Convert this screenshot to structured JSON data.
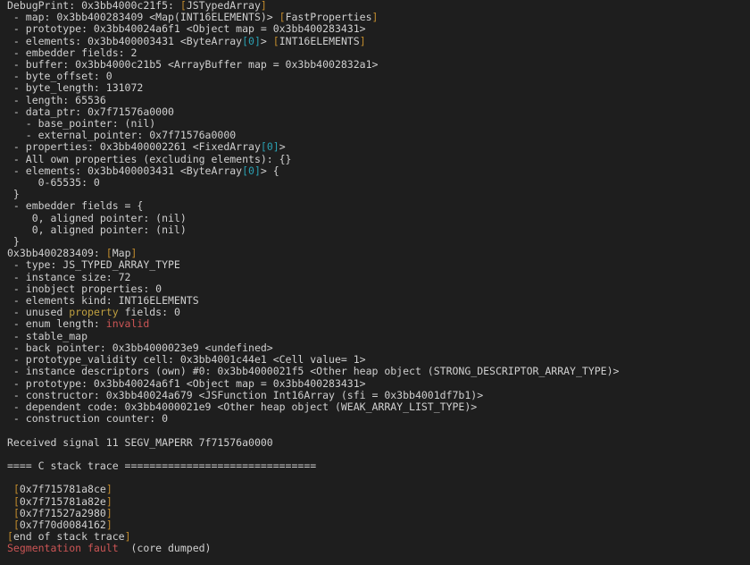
{
  "colors": {
    "bg": "#1e1e1e",
    "fg": "#d0d0d0",
    "cyan": "#2aa1b3",
    "orange": "#c08a2c",
    "yellow": "#c0a040",
    "red": "#cc5555"
  },
  "segments": [
    {
      "t": "DebugPrint: 0x3bb4000c21f5: "
    },
    {
      "t": "[",
      "c": "orange"
    },
    {
      "t": "JSTypedArray"
    },
    {
      "t": "]",
      "c": "orange"
    },
    {
      "t": "\n"
    },
    {
      "t": " - map: 0x3bb400283409 <Map(INT16ELEMENTS)> "
    },
    {
      "t": "[",
      "c": "orange"
    },
    {
      "t": "FastProperties"
    },
    {
      "t": "]",
      "c": "orange"
    },
    {
      "t": "\n"
    },
    {
      "t": " - prototype: 0x3bb40024a6f1 <Object map = 0x3bb400283431>\n"
    },
    {
      "t": " - elements: 0x3bb400003431 <ByteArray"
    },
    {
      "t": "[",
      "c": "cyan"
    },
    {
      "t": "0",
      "c": "cyan"
    },
    {
      "t": "]",
      "c": "cyan"
    },
    {
      "t": "> "
    },
    {
      "t": "[",
      "c": "orange"
    },
    {
      "t": "INT16ELEMENTS"
    },
    {
      "t": "]",
      "c": "orange"
    },
    {
      "t": "\n"
    },
    {
      "t": " - embedder fields: 2\n"
    },
    {
      "t": " - buffer: 0x3bb4000c21b5 <ArrayBuffer map = 0x3bb4002832a1>\n"
    },
    {
      "t": " - byte_offset: 0\n"
    },
    {
      "t": " - byte_length: 131072\n"
    },
    {
      "t": " - length: 65536\n"
    },
    {
      "t": " - data_ptr: 0x7f71576a0000\n"
    },
    {
      "t": "   - base_pointer: (nil)\n"
    },
    {
      "t": "   - external_pointer: 0x7f71576a0000\n"
    },
    {
      "t": " - properties: 0x3bb400002261 <FixedArray"
    },
    {
      "t": "[",
      "c": "cyan"
    },
    {
      "t": "0",
      "c": "cyan"
    },
    {
      "t": "]",
      "c": "cyan"
    },
    {
      "t": ">\n"
    },
    {
      "t": " - All own properties (excluding elements): {}\n"
    },
    {
      "t": " - elements: 0x3bb400003431 <ByteArray"
    },
    {
      "t": "[",
      "c": "cyan"
    },
    {
      "t": "0",
      "c": "cyan"
    },
    {
      "t": "]",
      "c": "cyan"
    },
    {
      "t": "> {\n"
    },
    {
      "t": "     0-65535: 0\n"
    },
    {
      "t": " }\n"
    },
    {
      "t": " - embedder fields = {\n"
    },
    {
      "t": "    0, aligned pointer: (nil)\n"
    },
    {
      "t": "    0, aligned pointer: (nil)\n"
    },
    {
      "t": " }\n"
    },
    {
      "t": "0x3bb400283409: "
    },
    {
      "t": "[",
      "c": "orange"
    },
    {
      "t": "Map"
    },
    {
      "t": "]",
      "c": "orange"
    },
    {
      "t": "\n"
    },
    {
      "t": " - type: JS_TYPED_ARRAY_TYPE\n"
    },
    {
      "t": " - instance size: 72\n"
    },
    {
      "t": " - inobject properties: 0\n"
    },
    {
      "t": " - elements kind: INT16ELEMENTS\n"
    },
    {
      "t": " - unused "
    },
    {
      "t": "property",
      "c": "yellow"
    },
    {
      "t": " fields: 0\n"
    },
    {
      "t": " - enum length: "
    },
    {
      "t": "invalid",
      "c": "red"
    },
    {
      "t": "\n"
    },
    {
      "t": " - stable_map\n"
    },
    {
      "t": " - back pointer: 0x3bb4000023e9 <undefined>\n"
    },
    {
      "t": " - prototype_validity cell: 0x3bb4001c44e1 <Cell value= 1>\n"
    },
    {
      "t": " - instance descriptors (own) #0: 0x3bb4000021f5 <Other heap object (STRONG_DESCRIPTOR_ARRAY_TYPE)>\n"
    },
    {
      "t": " - prototype: 0x3bb40024a6f1 <Object map = 0x3bb400283431>\n"
    },
    {
      "t": " - constructor: 0x3bb40024a679 <JSFunction Int16Array (sfi = 0x3bb4001df7b1)>\n"
    },
    {
      "t": " - dependent code: 0x3bb4000021e9 <Other heap object (WEAK_ARRAY_LIST_TYPE)>\n"
    },
    {
      "t": " - construction counter: 0\n"
    },
    {
      "t": "\n"
    },
    {
      "t": "Received signal 11 SEGV_MAPERR 7f71576a0000\n"
    },
    {
      "t": "\n"
    },
    {
      "t": "==== C stack trace ===============================\n"
    },
    {
      "t": "\n"
    },
    {
      "t": " "
    },
    {
      "t": "[",
      "c": "orange"
    },
    {
      "t": "0x7f715781a8ce"
    },
    {
      "t": "]",
      "c": "orange"
    },
    {
      "t": "\n"
    },
    {
      "t": " "
    },
    {
      "t": "[",
      "c": "orange"
    },
    {
      "t": "0x7f715781a82e"
    },
    {
      "t": "]",
      "c": "orange"
    },
    {
      "t": "\n"
    },
    {
      "t": " "
    },
    {
      "t": "[",
      "c": "orange"
    },
    {
      "t": "0x7f71527a2980"
    },
    {
      "t": "]",
      "c": "orange"
    },
    {
      "t": "\n"
    },
    {
      "t": " "
    },
    {
      "t": "[",
      "c": "orange"
    },
    {
      "t": "0x7f70d0084162"
    },
    {
      "t": "]",
      "c": "orange"
    },
    {
      "t": "\n"
    },
    {
      "t": "[",
      "c": "orange"
    },
    {
      "t": "end of stack trace"
    },
    {
      "t": "]",
      "c": "orange"
    },
    {
      "t": "\n"
    },
    {
      "t": "Segmentation fault",
      "c": "red"
    },
    {
      "t": "  (core dumped)"
    }
  ]
}
